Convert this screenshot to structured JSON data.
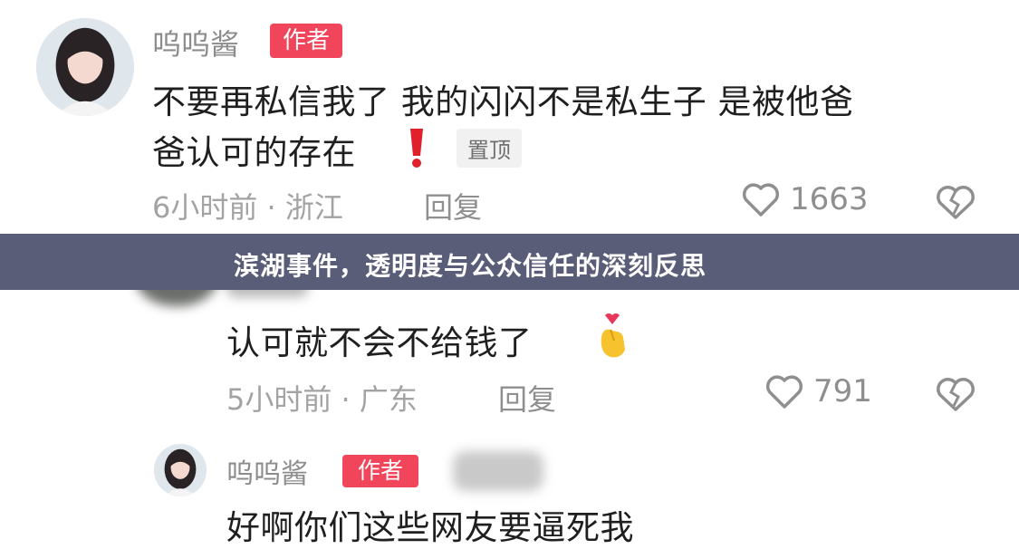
{
  "banner": {
    "title": "滨湖事件，透明度与公众信任的深刻反思"
  },
  "comments": [
    {
      "username": "呜呜酱",
      "badge": "作者",
      "text_line1": "不要再私信我了 我的闪闪不是私生子 是被他爸",
      "text_line2": "爸认可的存在",
      "pinned_label": "置顶",
      "meta": "6小时前 · 浙江",
      "reply_label": "回复",
      "likes": "1663"
    },
    {
      "text": "认可就不会不给钱了",
      "meta": "5小时前 · 广东",
      "reply_label": "回复",
      "likes": "791"
    },
    {
      "username": "呜呜酱",
      "badge": "作者",
      "text": "好啊你们这些网友要逼死我"
    }
  ],
  "colors": {
    "badge": "#f0455a",
    "banner": "#5a5d78",
    "exclaim": "#e0202a"
  },
  "icons": [
    "heart-icon",
    "broken-heart-icon",
    "exclamation-icon",
    "finger-heart-emoji"
  ]
}
